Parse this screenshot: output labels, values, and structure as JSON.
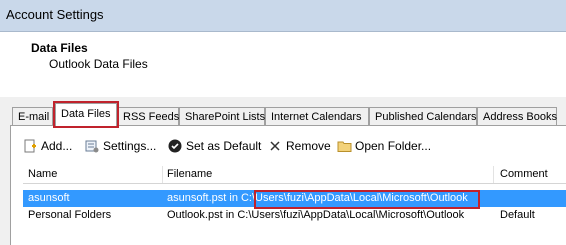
{
  "window": {
    "title": "Account Settings"
  },
  "header": {
    "title": "Data Files",
    "subtitle": "Outlook Data Files"
  },
  "tabs": [
    {
      "label": "E-mail"
    },
    {
      "label": "Data Files"
    },
    {
      "label": "RSS Feeds"
    },
    {
      "label": "SharePoint Lists"
    },
    {
      "label": "Internet Calendars"
    },
    {
      "label": "Published Calendars"
    },
    {
      "label": "Address Books"
    }
  ],
  "toolbar": {
    "add": "Add...",
    "settings": "Settings...",
    "set_default": "Set as Default",
    "remove": "Remove",
    "open_folder": "Open Folder..."
  },
  "table": {
    "columns": [
      "Name",
      "Filename",
      "Comment"
    ],
    "rows": [
      {
        "name": "asunsoft",
        "filename": "asunsoft.pst in C:\\Users\\fuzi\\AppData\\Local\\Microsoft\\Outlook",
        "comment": ""
      },
      {
        "name": "Personal Folders",
        "filename": "Outlook.pst in C:\\Users\\fuzi\\AppData\\Local\\Microsoft\\Outlook",
        "comment": "Default"
      }
    ]
  },
  "colors": {
    "selection": "#3399ff",
    "annotation": "#c0222c",
    "titlebar": "#c9d8ea"
  }
}
